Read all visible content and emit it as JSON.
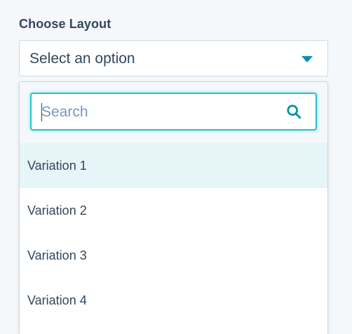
{
  "field": {
    "label": "Choose Layout"
  },
  "select": {
    "value": "Select an option",
    "caret_icon": "caret-down-icon"
  },
  "dropdown": {
    "search": {
      "placeholder": "Search",
      "value": "",
      "icon": "search-icon"
    },
    "options": [
      {
        "label": "Variation 1",
        "highlighted": true
      },
      {
        "label": "Variation 2",
        "highlighted": false
      },
      {
        "label": "Variation 3",
        "highlighted": false
      },
      {
        "label": "Variation 4",
        "highlighted": false
      }
    ]
  },
  "colors": {
    "accent": "#0091ae",
    "focus_border": "#26c1cf",
    "highlight_bg": "#e5f5f8",
    "text": "#33475b",
    "placeholder": "#7c98b6",
    "page_bg": "#f5f8fa"
  }
}
